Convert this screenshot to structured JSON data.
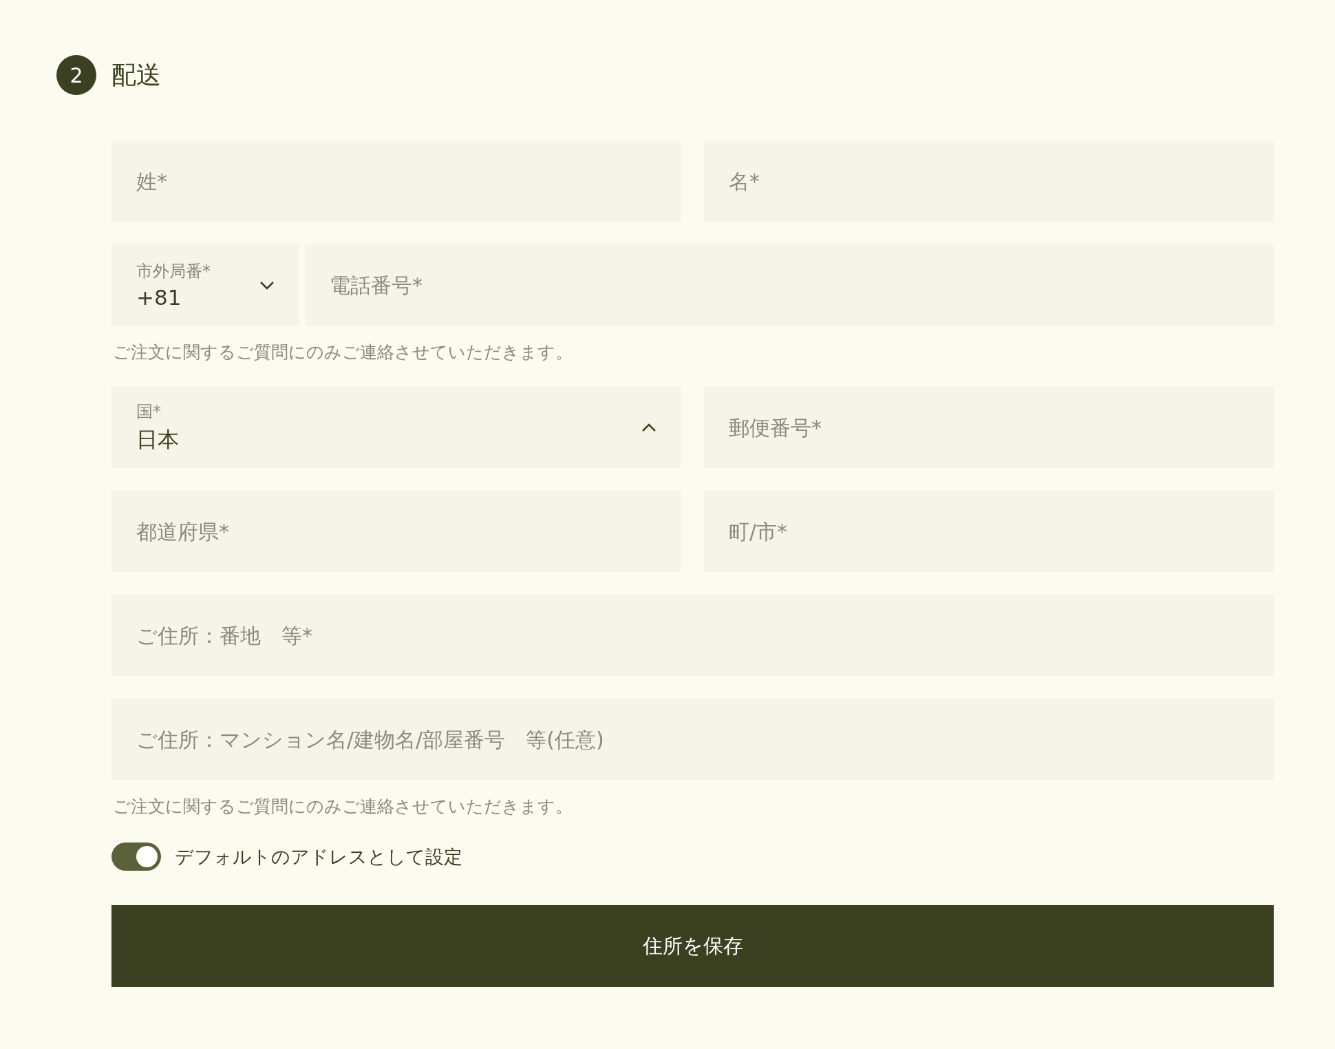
{
  "section": {
    "step": "2",
    "title": "配送"
  },
  "rows": [
    {
      "kind": "half",
      "fields": [
        {
          "kind": "text",
          "placeholder": "姓*"
        },
        {
          "kind": "text",
          "placeholder": "名*"
        }
      ]
    },
    {
      "kind": "phone",
      "fields": [
        {
          "kind": "select",
          "label": "市外局番*",
          "value": "+81",
          "expanded": false
        },
        {
          "kind": "text",
          "placeholder": "電話番号*"
        }
      ],
      "hint": "ご注文に関するご質問にのみご連絡させていただきます。"
    },
    {
      "kind": "half",
      "fields": [
        {
          "kind": "select",
          "label": "国*",
          "value": "日本",
          "expanded": true
        },
        {
          "kind": "text",
          "placeholder": "郵便番号*"
        }
      ]
    },
    {
      "kind": "half",
      "fields": [
        {
          "kind": "text",
          "placeholder": "都道府県*"
        },
        {
          "kind": "text",
          "placeholder": "町/市*"
        }
      ]
    },
    {
      "kind": "full",
      "fields": [
        {
          "kind": "text",
          "placeholder": "ご住所：番地　等*"
        }
      ]
    },
    {
      "kind": "full",
      "fields": [
        {
          "kind": "text",
          "placeholder": "ご住所：マンション名/建物名/部屋番号　等(任意)"
        }
      ],
      "hint": "ご注文に関するご質問にのみご連絡させていただきます。"
    }
  ],
  "toggle": {
    "label": "デフォルトのアドレスとして設定",
    "on": true
  },
  "button": {
    "label": "住所を保存"
  }
}
